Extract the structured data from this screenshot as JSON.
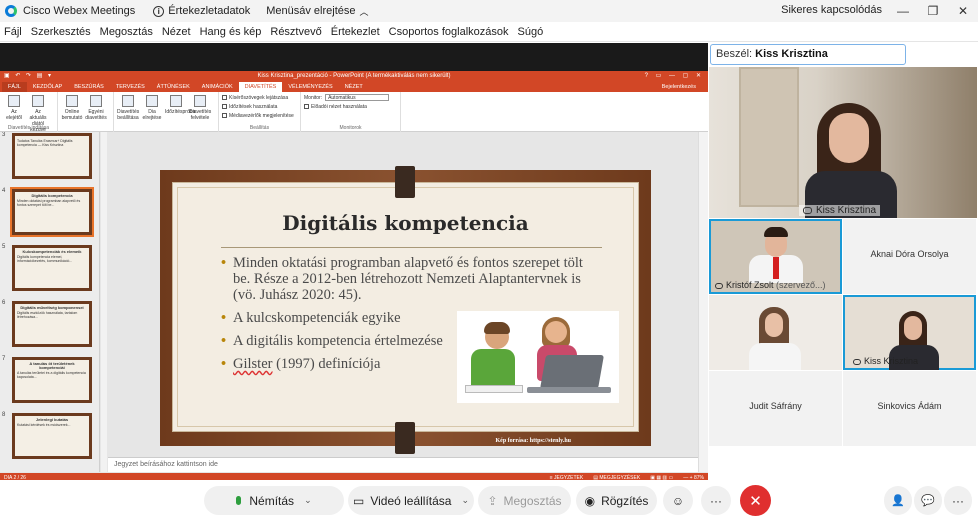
{
  "titlebar": {
    "app_title": "Cisco Webex Meetings",
    "info_label": "Értekezletadatok",
    "hide_menu_label": "Menüsáv elrejtése",
    "status": "Sikeres kapcsolódás",
    "minimize": "—",
    "restore": "❐",
    "close": "✕"
  },
  "menubar": {
    "items": [
      "Fájl",
      "Szerkesztés",
      "Megosztás",
      "Nézet",
      "Hang és kép",
      "Résztvevő",
      "Értekezlet",
      "Csoportos foglalkozások",
      "Súgó"
    ]
  },
  "ppt": {
    "window_title": "Kiss Krisztina_prezentáció - PowerPoint (A termékaktiválás nem sikerült)",
    "quick_access": "▣ ↶ ↷ ▤ ▾",
    "window_buttons": "? ▭ — ▢ ✕",
    "tabs": [
      "FÁJL",
      "KEZDŐLAP",
      "BESZÚRÁS",
      "TERVEZÉS",
      "ÁTTŰNÉSEK",
      "ANIMÁCIÓK",
      "DIAVETÍTÉS",
      "VÉLEMÉNYEZÉS",
      "NÉZET"
    ],
    "active_tab": "DIAVETÍTÉS",
    "user": "Bejelentkezés",
    "ribbon": {
      "group1_buttons": [
        "Az elejétől",
        "Az aktuális diától kezdve"
      ],
      "group1_name": "Diavetítés indítása",
      "group2_buttons": [
        "Online bemutató",
        "Egyéni diavetítés"
      ],
      "group3_buttons": [
        "Diavetítés beállítása",
        "Dia elrejtése",
        "Időzítéspróba",
        "Diavetítés felvétele"
      ],
      "group3_name": "Beállítás",
      "checks": [
        "Kísérőszövegek lejátszása",
        "Időzítések használata",
        "Médiavezérlők megjelenítése"
      ],
      "monitor_label": "Monitor:",
      "monitor_value": "Automatikus",
      "presenter_view": "Előadói nézet használata",
      "monitors_name": "Monitorok"
    },
    "thumbnails": [
      {
        "num": "3",
        "title": "",
        "text": "Tudatos Tanulás Erasmus+ Digitális kompetencia — Kiss Krisztina"
      },
      {
        "num": "4",
        "title": "Digitális kompetencia",
        "text": "Minden oktatási programban alapvető és fontos szerepet tölt be..."
      },
      {
        "num": "5",
        "title": "Kulcskompetenciák és elemeik",
        "text": "Digitális kompetencia elemei, információkezelés, kommunikáció..."
      },
      {
        "num": "6",
        "title": "Digitális műveltség komponensei",
        "text": "Digitális eszközök használata, tartalom létrehozása..."
      },
      {
        "num": "7",
        "title": "A tanulás öt területének kompetenciái",
        "text": "A tanulás területei és a digitális kompetencia kapcsolata..."
      },
      {
        "num": "8",
        "title": "Jelenlegi kutatás",
        "text": "Kutatási kérdések és módszerek..."
      }
    ],
    "slide": {
      "title": "Digitális kompetencia",
      "bullets": [
        "Minden oktatási programban alapvető és fontos szerepet tölt be. Része a 2012-ben létrehozott Nemzeti Alaptantervnek is (vö. Juhász 2020: 45).",
        "A kulcskompetenciák egyike",
        "A digitális kompetencia értelmezése"
      ],
      "last_bullet_prefix": "Gilster",
      "last_bullet_rest": " (1997) definíciója",
      "credit": "Kép forrása: https://stenly.hu"
    },
    "notes_placeholder": "Jegyzet beírásához kattintson ide",
    "status_left": "DIA 2 / 26",
    "status_right": [
      "≡ JEGYZETEK",
      "▤ MEGJEGYZÉSEK",
      "▣ ▦ ▥ ▭",
      "— + 87%"
    ]
  },
  "right_panel": {
    "speaker_prefix": "Beszél:",
    "speaker_name": "Kiss Krisztina",
    "main_video_label": "Kiss Krisztina",
    "tiles": [
      {
        "name": "Kristóf Zsolt",
        "role": "(szervező...)"
      },
      {
        "name": "Aknai Dóra Orsolya"
      },
      {
        "name": ""
      },
      {
        "name": "Kiss Krisztina"
      },
      {
        "name": "Judit Sáfrány"
      },
      {
        "name": "Sinkovics Ádám"
      }
    ]
  },
  "controls": {
    "mute": "Némítás",
    "video": "Videó leállítása",
    "share": "Megosztás",
    "record": "Rögzítés",
    "react_icon": "☺",
    "more_icon": "···",
    "end_icon": "✕",
    "participants_icon": "👤",
    "chat_icon": "💬",
    "dots_icon": "···"
  },
  "colors": {
    "ppt_accent": "#d24726",
    "webex_blue": "#1a9ad6",
    "end_red": "#e02f2f",
    "mic_green": "#2e9e3e"
  }
}
